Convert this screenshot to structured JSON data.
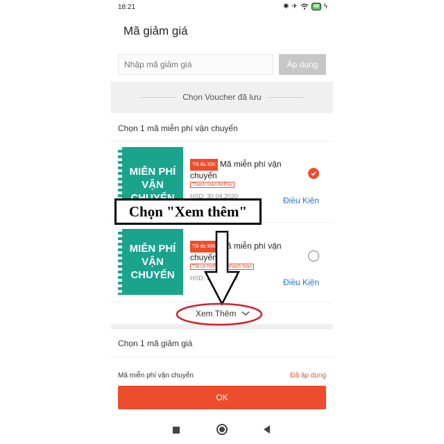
{
  "status_bar": {
    "time": "18:21",
    "battery": "48"
  },
  "page": {
    "title": "Mã giảm giá"
  },
  "code_entry": {
    "placeholder": "Nhập mã giảm giá",
    "apply_label": "Áp dụng"
  },
  "saved_section": {
    "label": "Chọn Voucher đã lưu"
  },
  "shipping_section": {
    "label": "Chọn 1 mã miễn phí vận chuyển",
    "vouchers": [
      {
        "badge_text": "MIỄN PHÍ VẬN CHUYỂN",
        "max_tag": "Tối đa 30K",
        "title": "Mã miễn phí vận chuyển",
        "payment_tag": "Thanh toán AirPay",
        "expiry": "HSD: 30.04.2020",
        "conditions_label": "Điều Kiện",
        "selected": true
      },
      {
        "badge_text": "MIỄN PHÍ VẬN CHUYỂN",
        "max_tag": "Tối đa 30K",
        "title": "Mã miễn phí vận chuyển",
        "payment_tag": "Tất cả hình thức thanh toán",
        "expiry": "HSD: 30.04.2020",
        "conditions_label": "Điều Kiện",
        "selected": false
      }
    ],
    "see_more_label": "Xem Thêm"
  },
  "discount_section": {
    "label": "Chọn 1 mã giảm giá"
  },
  "applied_row": {
    "label": "Mã miễn phí vận chuyển",
    "status": "Đã áp dụng"
  },
  "ok_label": "OK",
  "annotation": {
    "text": "Chọn \"Xem thêm\""
  },
  "colors": {
    "accent": "#ee4d2d",
    "voucher_green": "#1aa38d",
    "link_blue": "#2f6fd6",
    "annotation_red": "#d0202a"
  },
  "icons": {
    "checked": "check-circle-icon",
    "see_more": "chevron-down-icon",
    "nav": [
      "recents-square-icon",
      "home-circle-icon",
      "back-triangle-icon"
    ]
  }
}
